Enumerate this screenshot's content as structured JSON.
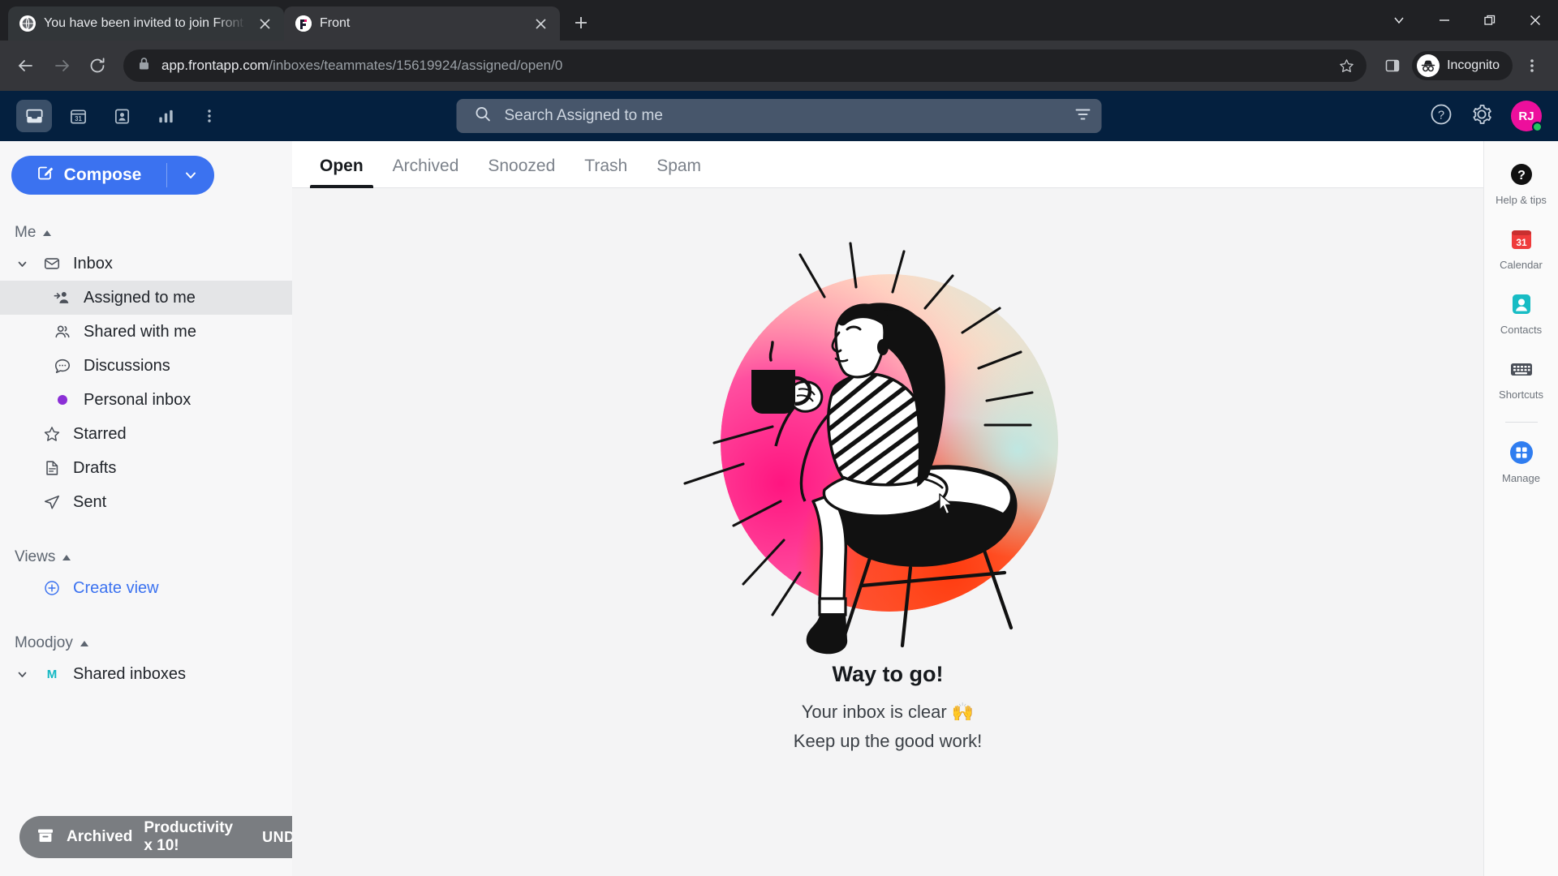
{
  "browser": {
    "tabs": [
      {
        "title": "You have been invited to join Front",
        "favicon": "globe-icon",
        "active": false
      },
      {
        "title": "Front",
        "favicon": "front-logo-icon",
        "active": true
      }
    ],
    "new_tab_label": "+",
    "window_controls": [
      "chevron-down-icon",
      "minimize-icon",
      "restore-icon",
      "close-icon"
    ],
    "url_domain": "app.frontapp.com",
    "url_path": "/inboxes/teammates/15619924/assigned/open/0",
    "profile_label": "Incognito",
    "back_icon": "back-arrow-icon",
    "forward_icon": "forward-arrow-icon",
    "reload_icon": "reload-icon",
    "lock_icon": "lock-icon",
    "star_icon": "star-icon",
    "sidepanel_icon": "side-panel-icon",
    "menu_icon": "kebab-menu-icon"
  },
  "topnav": {
    "icons": [
      {
        "name": "inbox-icon",
        "label": "Inbox",
        "selected": true
      },
      {
        "name": "calendar-icon",
        "label": "Calendar",
        "selected": false
      },
      {
        "name": "contacts-icon",
        "label": "Contacts",
        "selected": false
      },
      {
        "name": "analytics-icon",
        "label": "Analytics",
        "selected": false
      },
      {
        "name": "more-kebab-icon",
        "label": "More",
        "selected": false
      }
    ],
    "search_placeholder": "Search Assigned to me",
    "search_icon": "search-icon",
    "filter_icon": "filter-icon",
    "help_icon": "help-circle-icon",
    "settings_icon": "gear-icon",
    "avatar_initials": "RJ",
    "avatar_color": "#ed0f9c",
    "presence_color": "#22c55e"
  },
  "sidebar": {
    "compose_label": "Compose",
    "compose_icon": "compose-pencil-icon",
    "compose_caret_icon": "chevron-down-icon",
    "sections": [
      {
        "title": "Me",
        "caret": "caret-up-icon"
      },
      {
        "title": "Views",
        "caret": "caret-up-icon"
      },
      {
        "title": "Moodjoy",
        "caret": "caret-up-icon"
      }
    ],
    "me_items": [
      {
        "label": "Inbox",
        "icon": "envelope-icon",
        "chevron": "chevron-down-icon",
        "selected": false,
        "level": 1
      },
      {
        "label": "Assigned to me",
        "icon": "assigned-person-icon",
        "selected": true,
        "level": 2
      },
      {
        "label": "Shared with me",
        "icon": "people-icon",
        "selected": false,
        "level": 2
      },
      {
        "label": "Discussions",
        "icon": "chat-bubble-icon",
        "selected": false,
        "level": 2
      },
      {
        "label": "Personal inbox",
        "icon": "purple-dot-icon",
        "selected": false,
        "level": 2
      },
      {
        "label": "Starred",
        "icon": "star-outline-icon",
        "selected": false,
        "level": 1
      },
      {
        "label": "Drafts",
        "icon": "document-icon",
        "selected": false,
        "level": 1
      },
      {
        "label": "Sent",
        "icon": "paper-plane-icon",
        "selected": false,
        "level": 1
      }
    ],
    "create_view_label": "Create view",
    "create_view_icon": "plus-circle-icon",
    "team_item": {
      "label": "Shared inboxes",
      "badge": "M",
      "badge_color": "#14b8c4",
      "chevron": "chevron-down-icon"
    }
  },
  "toast": {
    "icon": "archive-box-icon",
    "action": "Archived",
    "subject": "Productivity x 10!",
    "undo_label": "UNDO"
  },
  "main": {
    "tabs": [
      {
        "label": "Open",
        "active": true
      },
      {
        "label": "Archived",
        "active": false
      },
      {
        "label": "Snoozed",
        "active": false
      },
      {
        "label": "Trash",
        "active": false
      },
      {
        "label": "Spam",
        "active": false
      }
    ],
    "empty_state": {
      "illustration": "woman-with-coffee-in-chair-illustration",
      "title": "Way to go!",
      "line1": "Your inbox is clear 🙌",
      "line2": "Keep up the good work!"
    }
  },
  "rail": {
    "items": [
      {
        "label": "Help & tips",
        "icon": "help-circle-icon",
        "color": "#111111"
      },
      {
        "label": "Calendar",
        "icon": "calendar-31-icon",
        "color": "#ef3b3b"
      },
      {
        "label": "Contacts",
        "icon": "contacts-person-icon",
        "color": "#18bcc4"
      },
      {
        "label": "Shortcuts",
        "icon": "keyboard-icon",
        "color": "#4b5059"
      },
      {
        "label": "Manage",
        "icon": "manage-grid-icon",
        "color": "#2f7df0"
      }
    ]
  }
}
